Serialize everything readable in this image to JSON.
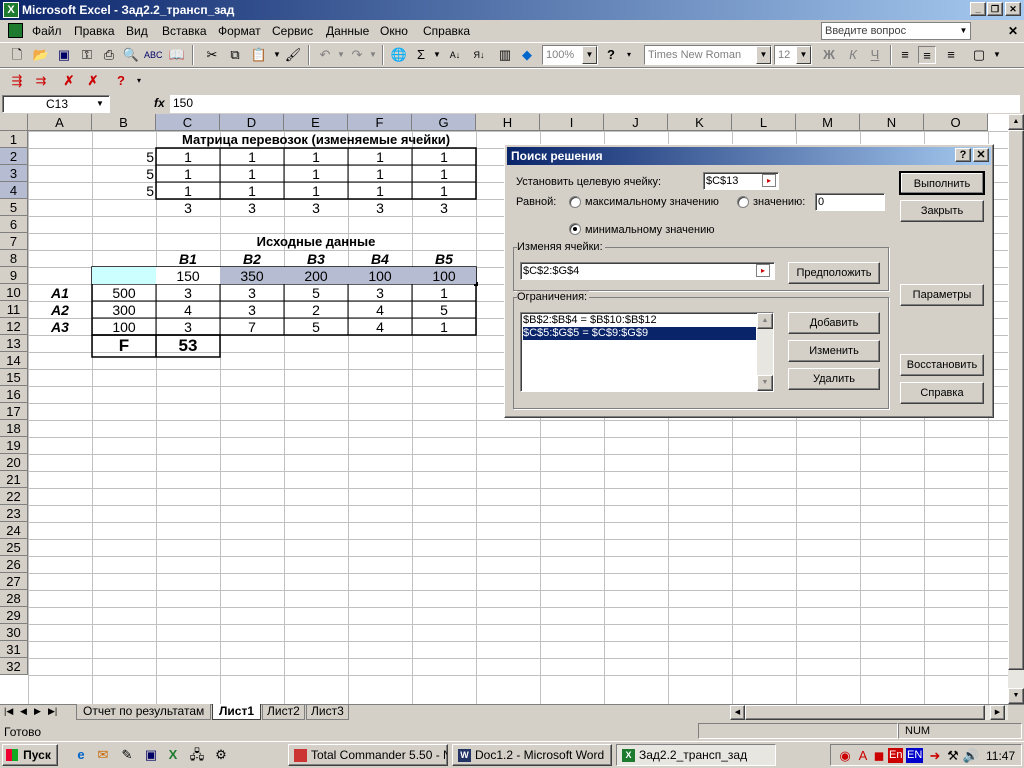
{
  "window": {
    "title": "Microsoft Excel - Зад2.2_трансп_зад",
    "ask_placeholder": "Введите вопрос"
  },
  "menu": [
    "Файл",
    "Правка",
    "Вид",
    "Вставка",
    "Формат",
    "Сервис",
    "Данные",
    "Окно",
    "Справка"
  ],
  "toolbar": {
    "zoom": "100%",
    "font": "Times New Roman",
    "size": "12",
    "bold": "Ж",
    "italic": "К",
    "underline": "Ч"
  },
  "formula_bar": {
    "name_box": "C13",
    "fx": "fx",
    "value": "150"
  },
  "columns": [
    "A",
    "B",
    "C",
    "D",
    "E",
    "F",
    "G",
    "H",
    "I",
    "J",
    "K",
    "L",
    "M",
    "N",
    "O"
  ],
  "rows": [
    "1",
    "2",
    "3",
    "4",
    "5",
    "6",
    "7",
    "8",
    "9",
    "10",
    "11",
    "12",
    "13",
    "14",
    "15",
    "16",
    "17",
    "18",
    "19",
    "20",
    "21",
    "22",
    "23",
    "24",
    "25",
    "26",
    "27",
    "28",
    "29",
    "30",
    "31",
    "32"
  ],
  "sheet": {
    "title1": "Матрица перевозок (изменяемые ячейки)",
    "title2": "Исходные данные",
    "b_col": [
      "5",
      "5",
      "5"
    ],
    "matrix": [
      [
        "1",
        "1",
        "1",
        "1",
        "1"
      ],
      [
        "1",
        "1",
        "1",
        "1",
        "1"
      ],
      [
        "1",
        "1",
        "1",
        "1",
        "1"
      ]
    ],
    "sums": [
      "3",
      "3",
      "3",
      "3",
      "3"
    ],
    "b_headers": [
      "B1",
      "B2",
      "B3",
      "B4",
      "B5"
    ],
    "demand": [
      "150",
      "350",
      "200",
      "100",
      "100"
    ],
    "a_labels": [
      "A1",
      "A2",
      "A3"
    ],
    "supply": [
      "500",
      "300",
      "100"
    ],
    "costs": [
      [
        "3",
        "3",
        "5",
        "3",
        "1"
      ],
      [
        "4",
        "3",
        "2",
        "4",
        "5"
      ],
      [
        "3",
        "7",
        "5",
        "4",
        "1"
      ]
    ],
    "f_label": "F",
    "f_value": "53"
  },
  "dialog": {
    "title": "Поиск решения",
    "help_btn": "?",
    "close_btn": "✕",
    "target_label": "Установить целевую ячейку:",
    "target_value": "$C$13",
    "equal_label": "Равной:",
    "opt_max": "максимальному значению",
    "opt_value": "значению:",
    "value_field": "0",
    "opt_min": "минимальному значению",
    "changing_label": "Изменяя ячейки:",
    "changing_value": "$C$2:$G$4",
    "guess_btn": "Предположить",
    "constraints_label": "Ограничения:",
    "constraints": [
      "$B$2:$B$4 = $B$10:$B$12",
      "$C$5:$G$5 = $C$9:$G$9"
    ],
    "run_btn": "Выполнить",
    "close_label": "Закрыть",
    "params_btn": "Параметры",
    "add_btn": "Добавить",
    "change_btn": "Изменить",
    "delete_btn": "Удалить",
    "restore_btn": "Восстановить",
    "help_label": "Справка"
  },
  "tabs": [
    "Отчет по результатам",
    "Лист1",
    "Лист2",
    "Лист3"
  ],
  "status": {
    "ready": "Готово",
    "num": "NUM"
  },
  "taskbar": {
    "start": "Пуск",
    "items": [
      "Total Commander 5.50 - N...",
      "Doc1.2 - Microsoft Word",
      "Зад2.2_трансп_зад"
    ],
    "lang1": "En",
    "lang2": "EN",
    "clock": "11:47"
  }
}
